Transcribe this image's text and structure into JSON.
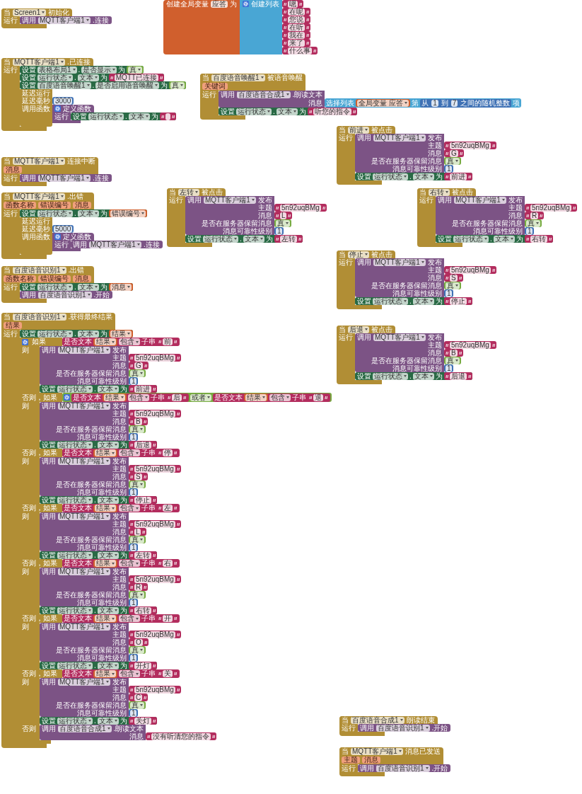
{
  "workspace": {
    "blocks": [
      {
        "kind": "event",
        "when": "当",
        "component": "Screen1",
        "event": "初始化",
        "run": "运行",
        "body": [
          {
            "kind": "call",
            "label": "调用",
            "component": "MQTT客户端1",
            "method": ".连接"
          }
        ]
      },
      {
        "kind": "global",
        "label": "创建全局变量",
        "name": "应答",
        "to": "为",
        "value": {
          "kind": "make_list",
          "label": "创建列表",
          "items": [
            {
              "kind": "text",
              "text": "嗯"
            },
            {
              "kind": "text",
              "text": "在呢"
            },
            {
              "kind": "text",
              "text": "您说"
            },
            {
              "kind": "text",
              "text": "在听"
            },
            {
              "kind": "text",
              "text": "我在"
            },
            {
              "kind": "text",
              "text": "来了"
            },
            {
              "kind": "text",
              "text": "什么事"
            }
          ]
        }
      },
      {
        "kind": "event",
        "when": "当",
        "component": "MQTT客户端1",
        "event": ".已连接",
        "run": "运行",
        "body": [
          {
            "kind": "set",
            "label": "设置",
            "component": "表格布局1",
            "dot": ".",
            "property": "是否显示",
            "to": "为",
            "value": {
              "kind": "bool",
              "text": "真"
            }
          },
          {
            "kind": "set",
            "label": "设置",
            "component": "运行状态",
            "dot": ".",
            "property": "文本",
            "to": "为",
            "value": {
              "kind": "text",
              "text": "MQTT已连接"
            }
          },
          {
            "kind": "set",
            "label": "设置",
            "component": "百度语音唤醒1",
            "dot": ".",
            "property": "是否启用语音唤醒",
            "to": "为",
            "value": {
              "kind": "bool",
              "text": "真"
            }
          },
          {
            "kind": "delay",
            "title": "延迟运行",
            "args": [
              {
                "name": "延迟毫秒",
                "value": {
                  "kind": "number",
                  "text": "3000"
                }
              },
              {
                "name": "调用函数",
                "value": {
                  "kind": "lambda",
                  "title": "定义函数",
                  "run": "运行",
                  "body": [
                    {
                      "kind": "set",
                      "label": "设置",
                      "component": "运行状态",
                      "dot": ".",
                      "property": "文本",
                      "to": "为",
                      "value": {
                        "kind": "empty_text"
                      }
                    }
                  ]
                }
              }
            ]
          }
        ]
      },
      {
        "kind": "event",
        "when": "当",
        "component": "百度语音唤醒1",
        "event": "被语音唤醒",
        "params": [
          "关键词"
        ],
        "run": "运行",
        "body": [
          {
            "kind": "call",
            "label": "调用",
            "component": "百度语音合成1",
            "method": ".朗读文本",
            "args": [
              {
                "name": "消息",
                "value": {
                  "kind": "select",
                  "label": "选择列表",
                  "list": {
                    "kind": "get",
                    "text": "全局变量 应答"
                  },
                  "index_label": "第",
                  "index": {
                    "kind": "random",
                    "from": "从",
                    "low": {
                      "kind": "number",
                      "text": "1"
                    },
                    "to": "到",
                    "high": {
                      "kind": "number",
                      "text": "7"
                    },
                    "suffix": "之间的随机整数"
                  },
                  "suffix": "项"
                }
              }
            ]
          },
          {
            "kind": "set",
            "label": "设置",
            "component": "运行状态",
            "dot": ".",
            "property": "文本",
            "to": "为",
            "value": {
              "kind": "text",
              "text": "听您的指令"
            }
          }
        ]
      },
      {
        "kind": "event",
        "when": "当",
        "component": "MQTT客户端1",
        "event": "连接中断",
        "params": [
          "消息"
        ],
        "run": "运行",
        "body": [
          {
            "kind": "call",
            "label": "调用",
            "component": "MQTT客户端1",
            "method": ".连接"
          }
        ]
      },
      {
        "kind": "event",
        "when": "当",
        "component": "前进",
        "event": "被点击",
        "run": "运行",
        "body": [
          {
            "kind": "call",
            "label": "调用",
            "component": "MQTT客户端1",
            "method": "发布",
            "args": [
              {
                "name": "主题",
                "value": {
                  "kind": "text",
                  "text": "5n92uqBMg"
                }
              },
              {
                "name": "消息",
                "value": {
                  "kind": "text",
                  "text": "G"
                }
              },
              {
                "name": "是否在服务器保留消息",
                "value": {
                  "kind": "bool",
                  "text": "真"
                }
              },
              {
                "name": "消息可靠性级别",
                "value": {
                  "kind": "number",
                  "text": "1"
                }
              }
            ]
          },
          {
            "kind": "set",
            "label": "设置",
            "component": "运行状态",
            "dot": ".",
            "property": "文本",
            "to": "为",
            "value": {
              "kind": "text",
              "text": "前进"
            }
          }
        ]
      },
      {
        "kind": "event",
        "when": "当",
        "component": "MQTT客户端1",
        "event": ".出错",
        "params": [
          "函数名称",
          "错误编号",
          "消息"
        ],
        "run": "运行",
        "body": [
          {
            "kind": "set",
            "label": "设置",
            "component": "运行状态",
            "dot": ".",
            "property": "文本",
            "to": "为",
            "value": {
              "kind": "get",
              "text": "错误编号"
            }
          },
          {
            "kind": "delay",
            "title": "延迟运行",
            "args": [
              {
                "name": "延迟毫秒",
                "value": {
                  "kind": "number",
                  "text": "5000"
                }
              },
              {
                "name": "调用函数",
                "value": {
                  "kind": "lambda",
                  "title": "定义函数",
                  "run": "运行",
                  "body": [
                    {
                      "kind": "call",
                      "label": "调用",
                      "component": "MQTT客户端1",
                      "method": ".连接"
                    }
                  ]
                }
              }
            ]
          }
        ]
      },
      {
        "kind": "event",
        "when": "当",
        "component": "左转",
        "event": "被点击",
        "run": "运行",
        "body": [
          {
            "kind": "call",
            "label": "调用",
            "component": "MQTT客户端1",
            "method": "发布",
            "args": [
              {
                "name": "主题",
                "value": {
                  "kind": "text",
                  "text": "5n92uqBMg"
                }
              },
              {
                "name": "消息",
                "value": {
                  "kind": "text",
                  "text": "L"
                }
              },
              {
                "name": "是否在服务器保留消息",
                "value": {
                  "kind": "bool",
                  "text": "真"
                }
              },
              {
                "name": "消息可靠性级别",
                "value": {
                  "kind": "number",
                  "text": "1"
                }
              }
            ]
          },
          {
            "kind": "set",
            "label": "设置",
            "component": "运行状态",
            "dot": ".",
            "property": "文本",
            "to": "为",
            "value": {
              "kind": "text",
              "text": "左转"
            }
          }
        ]
      },
      {
        "kind": "event",
        "when": "当",
        "component": "右转",
        "event": "被点击",
        "run": "运行",
        "body": [
          {
            "kind": "call",
            "label": "调用",
            "component": "MQTT客户端1",
            "method": "发布",
            "args": [
              {
                "name": "主题",
                "value": {
                  "kind": "text",
                  "text": "5n92uqBMg"
                }
              },
              {
                "name": "消息",
                "value": {
                  "kind": "text",
                  "text": "R"
                }
              },
              {
                "name": "是否在服务器保留消息",
                "value": {
                  "kind": "bool",
                  "text": "真"
                }
              },
              {
                "name": "消息可靠性级别",
                "value": {
                  "kind": "number",
                  "text": "1"
                }
              }
            ]
          },
          {
            "kind": "set",
            "label": "设置",
            "component": "运行状态",
            "dot": ".",
            "property": "文本",
            "to": "为",
            "value": {
              "kind": "text",
              "text": "右转"
            }
          }
        ]
      },
      {
        "kind": "event",
        "when": "当",
        "component": "百度语音识别1",
        "event": ".出错",
        "params": [
          "函数名称",
          "错误编号",
          "消息"
        ],
        "run": "运行",
        "body": [
          {
            "kind": "set",
            "label": "设置",
            "component": "运行状态",
            "dot": ".",
            "property": "文本",
            "to": "为",
            "value": {
              "kind": "get",
              "text": "消息"
            }
          },
          {
            "kind": "call",
            "label": "调用",
            "component": "百度语音识别1",
            "method": ".开始"
          }
        ]
      },
      {
        "kind": "event",
        "when": "当",
        "component": "停止",
        "event": "被点击",
        "run": "运行",
        "body": [
          {
            "kind": "call",
            "label": "调用",
            "component": "MQTT客户端1",
            "method": "发布",
            "args": [
              {
                "name": "主题",
                "value": {
                  "kind": "text",
                  "text": "5n92uqBMg"
                }
              },
              {
                "name": "消息",
                "value": {
                  "kind": "text",
                  "text": "S"
                }
              },
              {
                "name": "是否在服务器保留消息",
                "value": {
                  "kind": "bool",
                  "text": "真"
                }
              },
              {
                "name": "消息可靠性级别",
                "value": {
                  "kind": "number",
                  "text": "1"
                }
              }
            ]
          },
          {
            "kind": "set",
            "label": "设置",
            "component": "运行状态",
            "dot": ".",
            "property": "文本",
            "to": "为",
            "value": {
              "kind": "text",
              "text": "停止"
            }
          }
        ]
      },
      {
        "kind": "event",
        "when": "当",
        "component": "百度语音识别1",
        "event": ".获得最终结果",
        "params": [
          "结果"
        ],
        "run": "运行",
        "body": [
          {
            "kind": "set",
            "label": "设置",
            "component": "运行状态",
            "dot": ".",
            "property": "文本",
            "to": "为",
            "value": {
              "kind": "get",
              "text": "结果"
            }
          },
          {
            "kind": "if",
            "clauses": [
              {
                "label": "如果",
                "condition": {
                  "kind": "contains",
                  "label": "是否文本",
                  "text": {
                    "kind": "get",
                    "text": "结果"
                  },
                  "op": "包含",
                  "piece_label": "子串",
                  "piece": {
                    "kind": "text",
                    "text": "前"
                  }
                },
                "then": "则",
                "body": [
                  {
                    "kind": "call",
                    "label": "调用",
                    "component": "MQTT客户端1",
                    "method": "发布",
                    "args": [
                      {
                        "name": "主题",
                        "value": {
                          "kind": "text",
                          "text": "5n92uqBMg"
                        }
                      },
                      {
                        "name": "消息",
                        "value": {
                          "kind": "text",
                          "text": "G"
                        }
                      },
                      {
                        "name": "是否在服务器保留消息",
                        "value": {
                          "kind": "bool",
                          "text": "真"
                        }
                      },
                      {
                        "name": "消息可靠性级别",
                        "value": {
                          "kind": "number",
                          "text": "1"
                        }
                      }
                    ]
                  },
                  {
                    "kind": "set",
                    "label": "设置",
                    "component": "运行状态",
                    "dot": ".",
                    "property": "文本",
                    "to": "为",
                    "value": {
                      "kind": "text",
                      "text": "前进"
                    }
                  }
                ]
              },
              {
                "label": "否则，如果",
                "condition": {
                  "kind": "or",
                  "left": {
                    "kind": "contains",
                    "label": "是否文本",
                    "text": {
                      "kind": "get",
                      "text": "结果"
                    },
                    "op": "包含",
                    "piece_label": "子串",
                    "piece": {
                      "kind": "text",
                      "text": "后"
                    }
                  },
                  "op": "或者",
                  "right": {
                    "kind": "contains",
                    "label": "是否文本",
                    "text": {
                      "kind": "get",
                      "text": "结果"
                    },
                    "op": "包含",
                    "piece_label": "子串",
                    "piece": {
                      "kind": "text",
                      "text": "退"
                    }
                  }
                },
                "then": "则",
                "body": [
                  {
                    "kind": "call",
                    "label": "调用",
                    "component": "MQTT客户端1",
                    "method": "发布",
                    "args": [
                      {
                        "name": "主题",
                        "value": {
                          "kind": "text",
                          "text": "5n92uqBMg"
                        }
                      },
                      {
                        "name": "消息",
                        "value": {
                          "kind": "text",
                          "text": "B"
                        }
                      },
                      {
                        "name": "是否在服务器保留消息",
                        "value": {
                          "kind": "bool",
                          "text": "真"
                        }
                      },
                      {
                        "name": "消息可靠性级别",
                        "value": {
                          "kind": "number",
                          "text": "1"
                        }
                      }
                    ]
                  },
                  {
                    "kind": "set",
                    "label": "设置",
                    "component": "运行状态",
                    "dot": ".",
                    "property": "文本",
                    "to": "为",
                    "value": {
                      "kind": "text",
                      "text": "后退"
                    }
                  }
                ]
              },
              {
                "label": "否则，如果",
                "condition": {
                  "kind": "contains",
                  "label": "是否文本",
                  "text": {
                    "kind": "get",
                    "text": "结果"
                  },
                  "op": "包含",
                  "piece_label": "子串",
                  "piece": {
                    "kind": "text",
                    "text": "停"
                  }
                },
                "then": "则",
                "body": [
                  {
                    "kind": "call",
                    "label": "调用",
                    "component": "MQTT客户端1",
                    "method": "发布",
                    "args": [
                      {
                        "name": "主题",
                        "value": {
                          "kind": "text",
                          "text": "5n92uqBMg"
                        }
                      },
                      {
                        "name": "消息",
                        "value": {
                          "kind": "text",
                          "text": "S"
                        }
                      },
                      {
                        "name": "是否在服务器保留消息",
                        "value": {
                          "kind": "bool",
                          "text": "真"
                        }
                      },
                      {
                        "name": "消息可靠性级别",
                        "value": {
                          "kind": "number",
                          "text": "1"
                        }
                      }
                    ]
                  },
                  {
                    "kind": "set",
                    "label": "设置",
                    "component": "运行状态",
                    "dot": ".",
                    "property": "文本",
                    "to": "为",
                    "value": {
                      "kind": "text",
                      "text": "停止"
                    }
                  }
                ]
              },
              {
                "label": "否则，如果",
                "condition": {
                  "kind": "contains",
                  "label": "是否文本",
                  "text": {
                    "kind": "get",
                    "text": "结果"
                  },
                  "op": "包含",
                  "piece_label": "子串",
                  "piece": {
                    "kind": "text",
                    "text": "左"
                  }
                },
                "then": "则",
                "body": [
                  {
                    "kind": "call",
                    "label": "调用",
                    "component": "MQTT客户端1",
                    "method": "发布",
                    "args": [
                      {
                        "name": "主题",
                        "value": {
                          "kind": "text",
                          "text": "5n92uqBMg"
                        }
                      },
                      {
                        "name": "消息",
                        "value": {
                          "kind": "text",
                          "text": "L"
                        }
                      },
                      {
                        "name": "是否在服务器保留消息",
                        "value": {
                          "kind": "bool",
                          "text": "真"
                        }
                      },
                      {
                        "name": "消息可靠性级别",
                        "value": {
                          "kind": "number",
                          "text": "1"
                        }
                      }
                    ]
                  },
                  {
                    "kind": "set",
                    "label": "设置",
                    "component": "运行状态",
                    "dot": ".",
                    "property": "文本",
                    "to": "为",
                    "value": {
                      "kind": "text",
                      "text": "左转"
                    }
                  }
                ]
              },
              {
                "label": "否则，如果",
                "condition": {
                  "kind": "contains",
                  "label": "是否文本",
                  "text": {
                    "kind": "get",
                    "text": "结果"
                  },
                  "op": "包含",
                  "piece_label": "子串",
                  "piece": {
                    "kind": "text",
                    "text": "右"
                  }
                },
                "then": "则",
                "body": [
                  {
                    "kind": "call",
                    "label": "调用",
                    "component": "MQTT客户端1",
                    "method": "发布",
                    "args": [
                      {
                        "name": "主题",
                        "value": {
                          "kind": "text",
                          "text": "5n92uqBMg"
                        }
                      },
                      {
                        "name": "消息",
                        "value": {
                          "kind": "text",
                          "text": "R"
                        }
                      },
                      {
                        "name": "是否在服务器保留消息",
                        "value": {
                          "kind": "bool",
                          "text": "真"
                        }
                      },
                      {
                        "name": "消息可靠性级别",
                        "value": {
                          "kind": "number",
                          "text": "1"
                        }
                      }
                    ]
                  },
                  {
                    "kind": "set",
                    "label": "设置",
                    "component": "运行状态",
                    "dot": ".",
                    "property": "文本",
                    "to": "为",
                    "value": {
                      "kind": "text",
                      "text": "右转"
                    }
                  }
                ]
              },
              {
                "label": "否则，如果",
                "condition": {
                  "kind": "contains",
                  "label": "是否文本",
                  "text": {
                    "kind": "get",
                    "text": "结果"
                  },
                  "op": "包含",
                  "piece_label": "子串",
                  "piece": {
                    "kind": "text",
                    "text": "开"
                  }
                },
                "then": "则",
                "body": [
                  {
                    "kind": "call",
                    "label": "调用",
                    "component": "MQTT客户端1",
                    "method": "发布",
                    "args": [
                      {
                        "name": "主题",
                        "value": {
                          "kind": "text",
                          "text": "5n92uqBMg"
                        }
                      },
                      {
                        "name": "消息",
                        "value": {
                          "kind": "text",
                          "text": "O"
                        }
                      },
                      {
                        "name": "是否在服务器保留消息",
                        "value": {
                          "kind": "bool",
                          "text": "真"
                        }
                      },
                      {
                        "name": "消息可靠性级别",
                        "value": {
                          "kind": "number",
                          "text": "1"
                        }
                      }
                    ]
                  },
                  {
                    "kind": "set",
                    "label": "设置",
                    "component": "运行状态",
                    "dot": ".",
                    "property": "文本",
                    "to": "为",
                    "value": {
                      "kind": "text",
                      "text": "开灯"
                    }
                  }
                ]
              },
              {
                "label": "否则，如果",
                "condition": {
                  "kind": "contains",
                  "label": "是否文本",
                  "text": {
                    "kind": "get",
                    "text": "结果"
                  },
                  "op": "包含",
                  "piece_label": "子串",
                  "piece": {
                    "kind": "text",
                    "text": "关"
                  }
                },
                "then": "则",
                "body": [
                  {
                    "kind": "call",
                    "label": "调用",
                    "component": "MQTT客户端1",
                    "method": "发布",
                    "args": [
                      {
                        "name": "主题",
                        "value": {
                          "kind": "text",
                          "text": "5n92uqBMg"
                        }
                      },
                      {
                        "name": "消息",
                        "value": {
                          "kind": "text",
                          "text": "C"
                        }
                      },
                      {
                        "name": "是否在服务器保留消息",
                        "value": {
                          "kind": "bool",
                          "text": "真"
                        }
                      },
                      {
                        "name": "消息可靠性级别",
                        "value": {
                          "kind": "number",
                          "text": "1"
                        }
                      }
                    ]
                  },
                  {
                    "kind": "set",
                    "label": "设置",
                    "component": "运行状态",
                    "dot": ".",
                    "property": "文本",
                    "to": "为",
                    "value": {
                      "kind": "text",
                      "text": "关灯"
                    }
                  }
                ]
              }
            ],
            "else": "否则",
            "else_body": [
              {
                "kind": "call",
                "label": "调用",
                "component": "百度语音合成1",
                "method": ".朗读文本",
                "args": [
                  {
                    "name": "消息",
                    "value": {
                      "kind": "text",
                      "text": "没有听清您的指令"
                    }
                  }
                ]
              }
            ]
          }
        ]
      },
      {
        "kind": "event",
        "when": "当",
        "component": "后退",
        "event": "被点击",
        "run": "运行",
        "body": [
          {
            "kind": "call",
            "label": "调用",
            "component": "MQTT客户端1",
            "method": "发布",
            "args": [
              {
                "name": "主题",
                "value": {
                  "kind": "text",
                  "text": "5n92uqBMg"
                }
              },
              {
                "name": "消息",
                "value": {
                  "kind": "text",
                  "text": "B"
                }
              },
              {
                "name": "是否在服务器保留消息",
                "value": {
                  "kind": "bool",
                  "text": "真"
                }
              },
              {
                "name": "消息可靠性级别",
                "value": {
                  "kind": "number",
                  "text": "1"
                }
              }
            ]
          },
          {
            "kind": "set",
            "label": "设置",
            "component": "运行状态",
            "dot": ".",
            "property": "文本",
            "to": "为",
            "value": {
              "kind": "text",
              "text": "后退"
            }
          }
        ]
      },
      {
        "kind": "event",
        "when": "当",
        "component": "百度语音合成1",
        "event": "朗读结束",
        "run": "运行",
        "body": [
          {
            "kind": "call",
            "label": "调用",
            "component": "百度语音识别1",
            "method": ".开始"
          }
        ]
      },
      {
        "kind": "event",
        "when": "当",
        "component": "MQTT客户端1",
        "event": "消息已发送",
        "params": [
          "主题",
          "消息"
        ],
        "run": "运行",
        "body": [
          {
            "kind": "call",
            "label": "调用",
            "component": "百度语音识别1",
            "method": ".开始"
          }
        ]
      }
    ]
  }
}
